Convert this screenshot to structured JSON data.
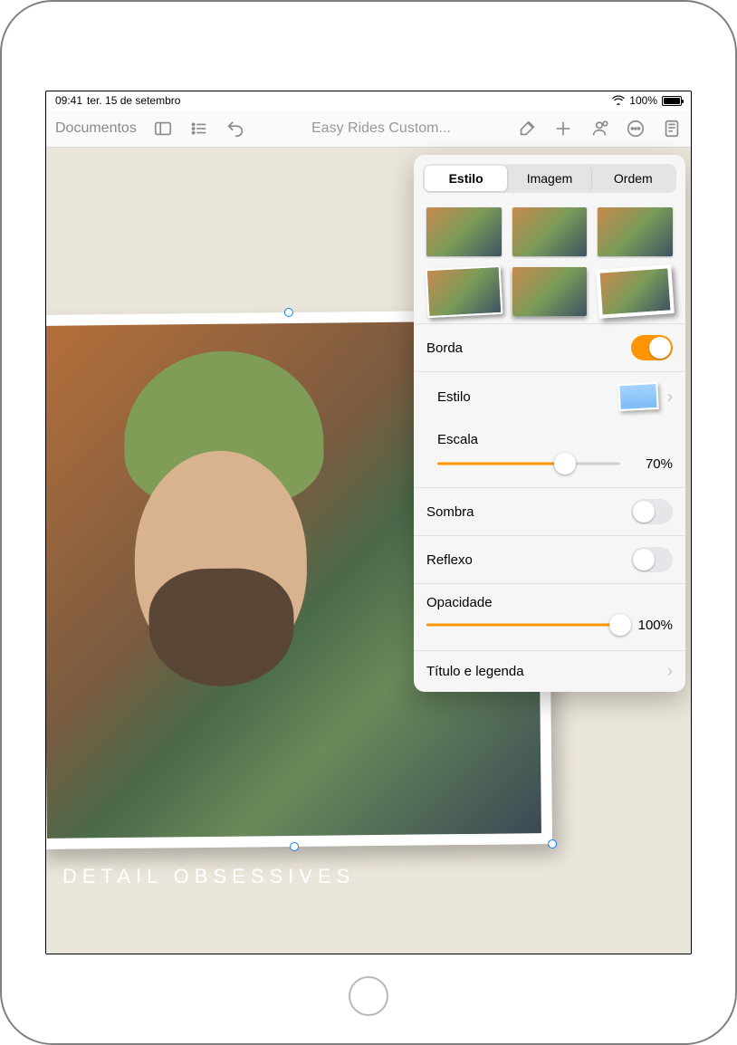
{
  "status": {
    "time": "09:41",
    "date": "ter. 15 de setembro",
    "battery_pct": "100%"
  },
  "toolbar": {
    "back_label": "Documentos",
    "title": "Easy Rides Custom..."
  },
  "canvas": {
    "caption": "DETAIL OBSESSIVES"
  },
  "popover": {
    "tabs": {
      "style": "Estilo",
      "image": "Imagem",
      "order": "Ordem",
      "active": "Estilo"
    },
    "border": {
      "label": "Borda",
      "on": true
    },
    "style_row": {
      "label": "Estilo"
    },
    "scale": {
      "label": "Escala",
      "value_pct": 70,
      "display": "70%"
    },
    "shadow": {
      "label": "Sombra",
      "on": false
    },
    "reflection": {
      "label": "Reflexo",
      "on": false
    },
    "opacity": {
      "label": "Opacidade",
      "value_pct": 100,
      "display": "100%"
    },
    "title_caption": {
      "label": "Título e legenda"
    }
  }
}
